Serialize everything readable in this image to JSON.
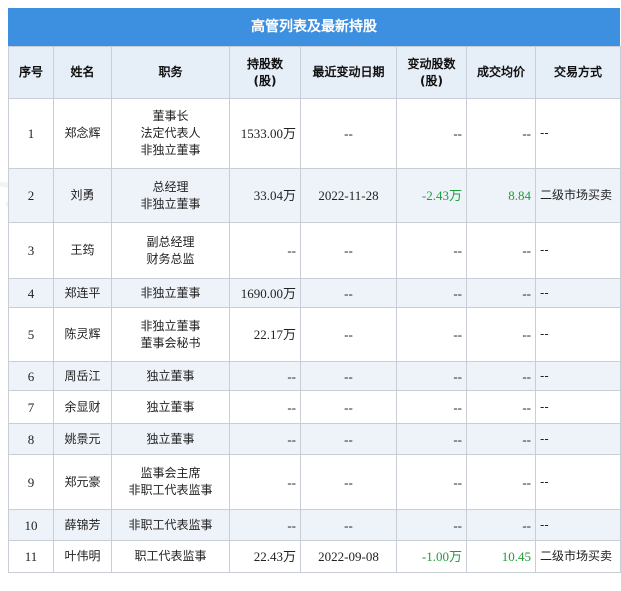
{
  "title": "高管列表及最新持股",
  "headers": [
    "序号",
    "姓名",
    "职务",
    "持股数\n(股)",
    "最近变动日期",
    "变动股数\n(股)",
    "成交均价",
    "交易方式"
  ],
  "header_lines": [
    [
      "序号"
    ],
    [
      "姓名"
    ],
    [
      "职务"
    ],
    [
      "持股数",
      "(股)"
    ],
    [
      "最近变动日期"
    ],
    [
      "变动股数",
      "(股)"
    ],
    [
      "成交均价"
    ],
    [
      "交易方式"
    ]
  ],
  "rows": [
    {
      "idx": "1",
      "name": "郑念辉",
      "roles": [
        "董事长",
        "法定代表人",
        "非独立董事"
      ],
      "shares": "1533.00万",
      "date": "--",
      "change": "--",
      "price": "--",
      "way": "--",
      "height": 70
    },
    {
      "idx": "2",
      "name": "刘勇",
      "roles": [
        "总经理",
        "非独立董事"
      ],
      "shares": "33.04万",
      "date": "2022-11-28",
      "change": "-2.43万",
      "price": "8.84",
      "way": "二级市场买卖",
      "height": 54
    },
    {
      "idx": "3",
      "name": "王筠",
      "roles": [
        "副总经理",
        "财务总监"
      ],
      "shares": "--",
      "date": "--",
      "change": "--",
      "price": "--",
      "way": "--",
      "height": 56
    },
    {
      "idx": "4",
      "name": "郑连平",
      "roles": [
        "非独立董事"
      ],
      "shares": "1690.00万",
      "date": "--",
      "change": "--",
      "price": "--",
      "way": "--",
      "height": 29
    },
    {
      "idx": "5",
      "name": "陈灵辉",
      "roles": [
        "非独立董事",
        "董事会秘书"
      ],
      "shares": "22.17万",
      "date": "--",
      "change": "--",
      "price": "--",
      "way": "--",
      "height": 54
    },
    {
      "idx": "6",
      "name": "周岳江",
      "roles": [
        "独立董事"
      ],
      "shares": "--",
      "date": "--",
      "change": "--",
      "price": "--",
      "way": "--",
      "height": 29
    },
    {
      "idx": "7",
      "name": "余显财",
      "roles": [
        "独立董事"
      ],
      "shares": "--",
      "date": "--",
      "change": "--",
      "price": "--",
      "way": "--",
      "height": 33
    },
    {
      "idx": "8",
      "name": "姚景元",
      "roles": [
        "独立董事"
      ],
      "shares": "--",
      "date": "--",
      "change": "--",
      "price": "--",
      "way": "--",
      "height": 31
    },
    {
      "idx": "9",
      "name": "郑元豪",
      "roles": [
        "监事会主席",
        "非职工代表监事"
      ],
      "shares": "--",
      "date": "--",
      "change": "--",
      "price": "--",
      "way": "--",
      "height": 55
    },
    {
      "idx": "10",
      "name": "薛锦芳",
      "roles": [
        "非职工代表监事"
      ],
      "shares": "--",
      "date": "--",
      "change": "--",
      "price": "--",
      "way": "--",
      "height": 31
    },
    {
      "idx": "11",
      "name": "叶伟明",
      "roles": [
        "职工代表监事"
      ],
      "shares": "22.43万",
      "date": "2022-09-08",
      "change": "-1.00万",
      "price": "10.45",
      "way": "二级市场买卖",
      "height": 32
    }
  ],
  "colors": {
    "header_bar": "#3d8fe0",
    "header_row": "#e6eef8",
    "stripe": "#eef3fa",
    "positive_change": "#1f9d3a"
  }
}
